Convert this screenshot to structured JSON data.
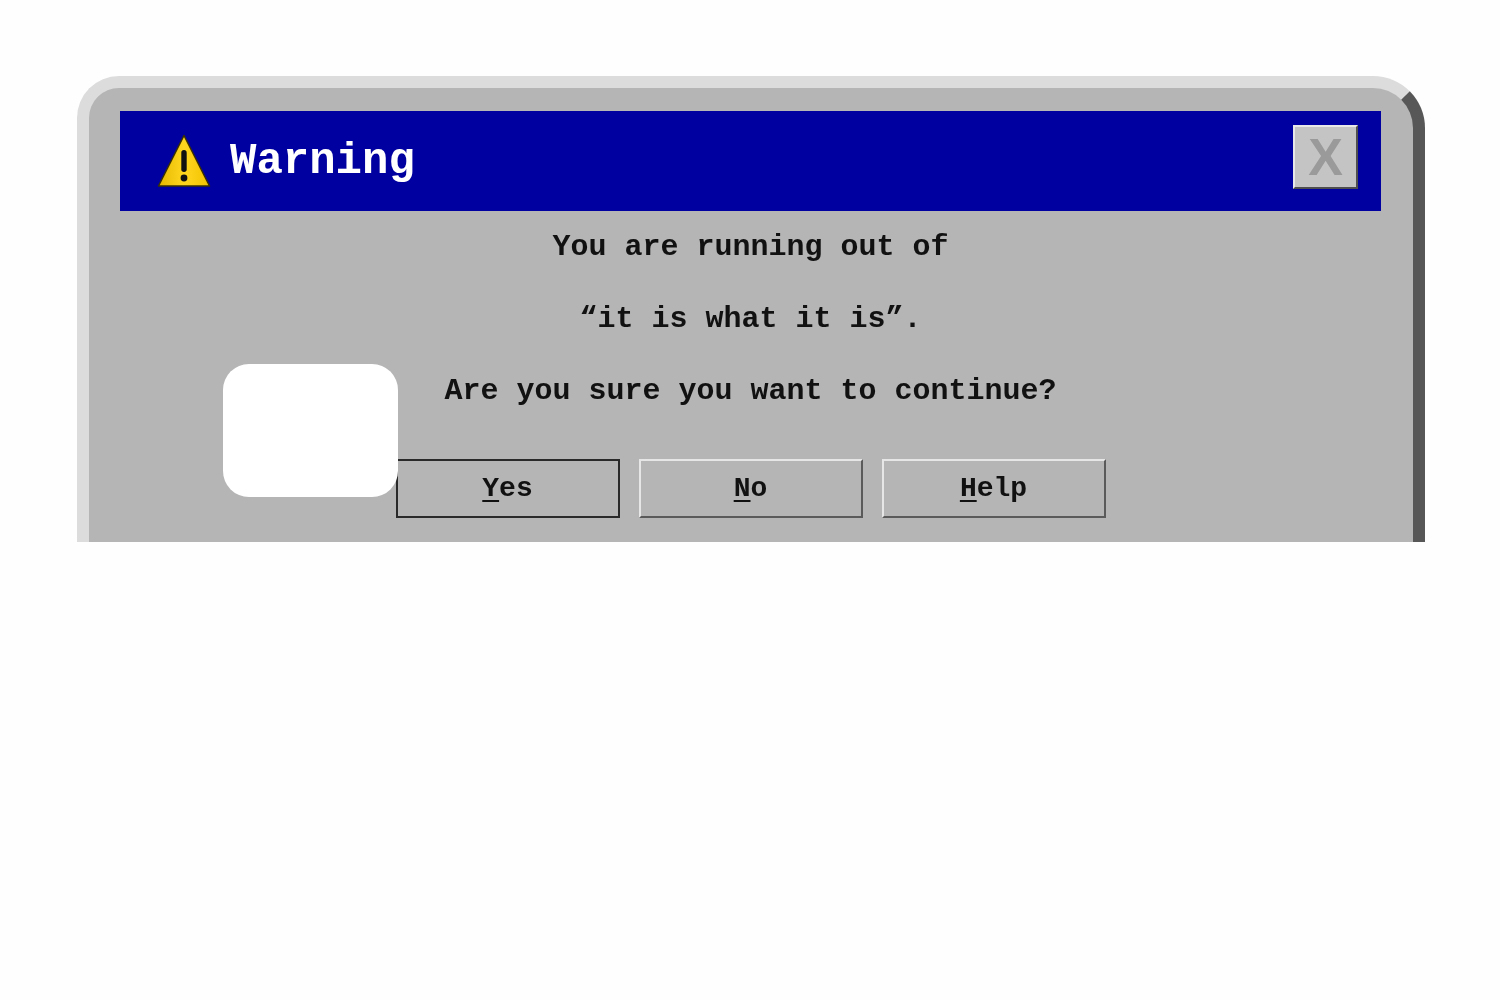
{
  "window": {
    "title": "Warning",
    "close_button": {
      "label": "X",
      "disabled": true
    }
  },
  "message": "You are running out of “it is what it is”.",
  "question": "Are you sure you want to continue?",
  "buttons": [
    {
      "label": "Yes",
      "default": true,
      "mnemonic_underlined": true
    },
    {
      "label": "No",
      "default": false,
      "mnemonic_underlined": true
    },
    {
      "label": "Help",
      "default": false,
      "mnemonic_underlined": true
    }
  ]
}
